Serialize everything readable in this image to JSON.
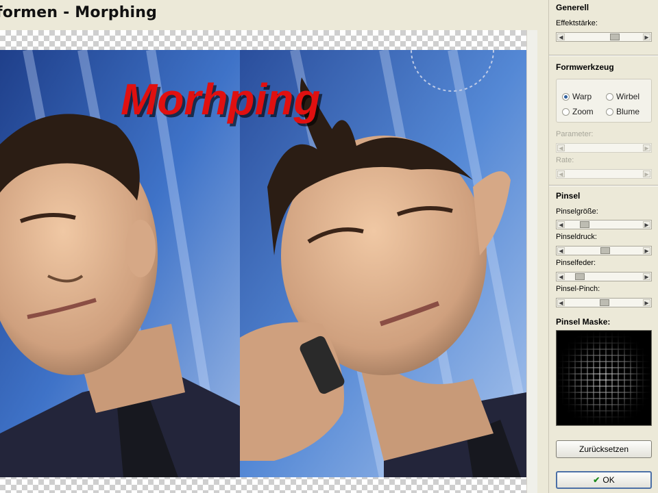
{
  "window": {
    "title": "formen - Morphing"
  },
  "image": {
    "overlay_text": "Morhping"
  },
  "sections": {
    "generell": {
      "title": "Generell",
      "effektstaerke_label": "Effektstärke:",
      "effektstaerke_value": 0.58
    },
    "formwerkzeug": {
      "title": "Formwerkzeug",
      "options": [
        {
          "label": "Warp",
          "selected": true
        },
        {
          "label": "Wirbel",
          "selected": false
        },
        {
          "label": "Zoom",
          "selected": false
        },
        {
          "label": "Blume",
          "selected": false
        }
      ],
      "parameter_label": "Parameter:",
      "rate_label": "Rate:"
    },
    "pinsel": {
      "title": "Pinsel",
      "groesse_label": "Pinselgröße:",
      "groesse_value": 0.27,
      "druck_label": "Pinseldruck:",
      "druck_value": 0.55,
      "feder_label": "Pinselfeder:",
      "feder_value": 0.22,
      "pinch_label": "Pinsel-Pinch:",
      "pinch_value": 0.5,
      "maske_label": "Pinsel Maske:"
    }
  },
  "buttons": {
    "reset_label": "Zurücksetzen",
    "ok_label": "OK"
  },
  "colors": {
    "background": "#ece9d8",
    "accent": "#2e5f9c",
    "overlay_text": "#e01010"
  }
}
